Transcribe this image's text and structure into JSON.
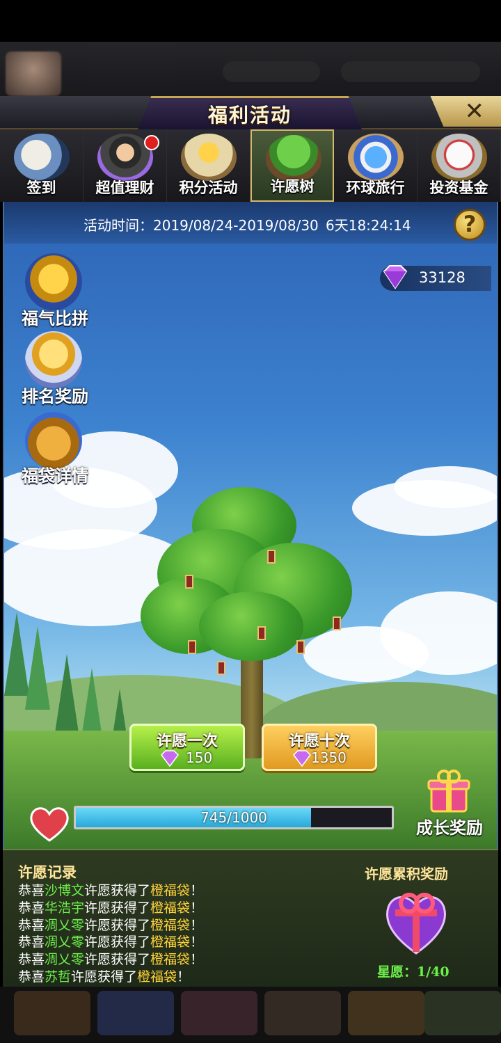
{
  "header": {
    "title": "福利活动",
    "close_icon": "close-icon"
  },
  "tabs": [
    {
      "label": "签到",
      "icon": "sign-in-icon"
    },
    {
      "label": "超值理财",
      "icon": "finance-icon",
      "badge": true
    },
    {
      "label": "积分活动",
      "icon": "points-icon"
    },
    {
      "label": "许愿树",
      "icon": "wish-tree-icon",
      "active": true
    },
    {
      "label": "环球旅行",
      "icon": "travel-icon"
    },
    {
      "label": "投资基金",
      "icon": "fund-icon"
    }
  ],
  "activity": {
    "time_label": "活动时间：2019/08/24-2019/08/30",
    "countdown": "6天18:24:14",
    "help": "?"
  },
  "wallet": {
    "diamonds": "33128"
  },
  "side_menu": [
    {
      "label": "福气比拼",
      "icon": "trophy-icon"
    },
    {
      "label": "排名奖励",
      "icon": "star-rank-icon"
    },
    {
      "label": "福袋详情",
      "icon": "lucky-bag-icon"
    }
  ],
  "wish": {
    "once_label": "许愿一次",
    "once_cost": "150",
    "ten_label": "许愿十次",
    "ten_cost": "1350"
  },
  "progress": {
    "text": "745/1000",
    "current": 745,
    "max": 1000
  },
  "growth": {
    "label": "成长奖励"
  },
  "record": {
    "title": "许愿记录",
    "prefix": "恭喜",
    "middle": "许愿获得了",
    "suffix": "！",
    "entries": [
      {
        "name": "沙博文",
        "item": "橙福袋"
      },
      {
        "name": "华浩宇",
        "item": "橙福袋"
      },
      {
        "name": "凋乂零",
        "item": "橙福袋"
      },
      {
        "name": "凋乂零",
        "item": "橙福袋"
      },
      {
        "name": "凋乂零",
        "item": "橙福袋"
      },
      {
        "name": "苏哲",
        "item": "橙福袋"
      }
    ]
  },
  "accumulate": {
    "title": "许愿累积奖励",
    "star_wish": "星愿：1/40"
  },
  "colors": {
    "accent_gold": "#ffe59a",
    "name_green": "#6cf04a",
    "item_orange": "#ffd23a",
    "progress_blue": "#28a8d8"
  }
}
